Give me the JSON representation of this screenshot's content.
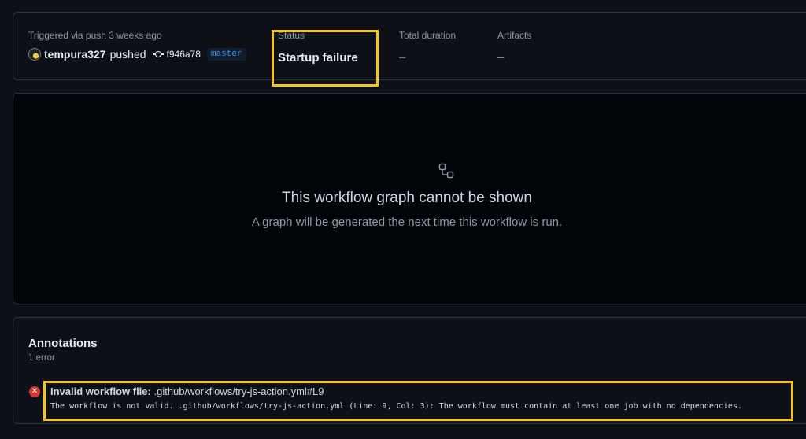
{
  "summary": {
    "trigger_text": "Triggered via push 3 weeks ago",
    "user": "tempura327",
    "action": "pushed",
    "commit_sha": "f946a78",
    "branch": "master",
    "status_label": "Status",
    "status_value": "Startup failure",
    "duration_label": "Total duration",
    "duration_value": "–",
    "artifacts_label": "Artifacts",
    "artifacts_value": "–"
  },
  "graph": {
    "icon": "workflow-icon",
    "title": "This workflow graph cannot be shown",
    "subtitle": "A graph will be generated the next time this workflow is run."
  },
  "annotations": {
    "title": "Annotations",
    "count": "1 error",
    "items": [
      {
        "icon": "error-x-icon",
        "label": "Invalid workflow file:",
        "file": ".github/workflows/try-js-action.yml#L9",
        "message": "The workflow is not valid. .github/workflows/try-js-action.yml (Line: 9, Col: 3): The workflow must contain at least one job with no dependencies."
      }
    ]
  },
  "colors": {
    "background": "#0d1117",
    "highlight": "#f5c518",
    "error": "#da3633",
    "branch": "#4493f8"
  }
}
